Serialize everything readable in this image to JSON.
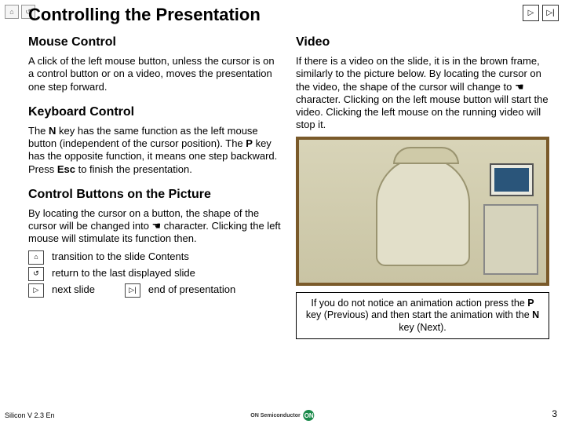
{
  "nav": {
    "home_title": "Contents",
    "back_title": "Back",
    "next_title": "Next",
    "end_title": "End"
  },
  "title": "Controlling the Presentation",
  "left": {
    "mouse_h": "Mouse Control",
    "mouse_p": "A click of the left mouse button, unless the cursor is on a control button or on a video, moves the presentation one step forward.",
    "kbd_h": "Keyboard Control",
    "kbd_p_pre": "The ",
    "kbd_p_nkey": "N",
    "kbd_p_mid1": " key has the same function as the left mouse button (independent of the cursor position). The ",
    "kbd_p_pkey": "P",
    "kbd_p_mid2": " key has the opposite function, it means one step backward. Press ",
    "kbd_p_esc": "Esc",
    "kbd_p_end": " to finish the presentation.",
    "ctrl_h": "Control Buttons on the Picture",
    "ctrl_p_pre": "By locating the cursor on a button, the shape of the cursor will be changed into ",
    "ctrl_p_hand": "☚",
    "ctrl_p_post": " character. Clicking the left mouse will stimulate its function then.",
    "row1": "transition to the slide Contents",
    "row2": "return to the last displayed slide",
    "row3a": "next slide",
    "row3b": "end of presentation"
  },
  "right": {
    "video_h": "Video",
    "video_p_pre": "If there is a video on the slide, it is in the brown frame, similarly to the picture below. By locating the cursor on the video, the shape of the cursor will change to ",
    "video_p_hand": "☚",
    "video_p_post": " character. Clicking on the left mouse button will start the video. Clicking the left mouse on the running video will stop it.",
    "note_pre": "If you do not notice an animation action press the ",
    "note_p": "P",
    "note_mid1": " key (Previous) and then start the animation with the ",
    "note_n": "N",
    "note_end": " key (Next)."
  },
  "footer": {
    "left": "Silicon V 2.3 En",
    "brand": "ON Semiconductor",
    "logo": "ON",
    "page": "3"
  },
  "icons": {
    "home": "⌂",
    "back": "↺",
    "next": "▷",
    "end": "▷|"
  }
}
